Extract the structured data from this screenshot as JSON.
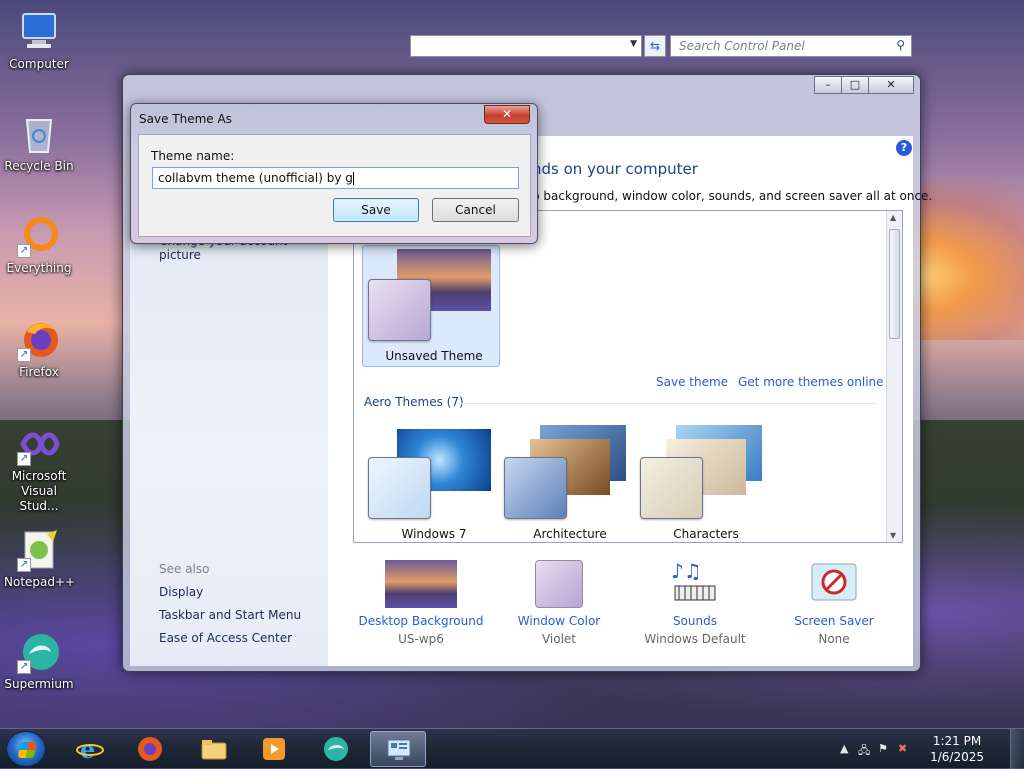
{
  "desktop": {
    "icons": [
      {
        "label": "Computer"
      },
      {
        "label": "Recycle Bin"
      },
      {
        "label": "Everything"
      },
      {
        "label": "Firefox"
      },
      {
        "label": "Microsoft Visual Stud..."
      },
      {
        "label": "Notepad++"
      },
      {
        "label": "Supermium"
      }
    ]
  },
  "control_panel": {
    "search_placeholder": "Search Control Panel",
    "heading_fragment": "nds on your computer",
    "subtitle_fragment": "p background, window color, sounds, and screen saver all at once.",
    "left_link_partial": "Change your account picture",
    "see_also_title": "See also",
    "see_also_links": [
      "Display",
      "Taskbar and Start Menu",
      "Ease of Access Center"
    ],
    "my_themes": {
      "name": "Unsaved Theme"
    },
    "save_theme_link": "Save theme",
    "get_more_link": "Get more themes online",
    "aero_title": "Aero Themes (7)",
    "aero_themes": [
      {
        "name": "Windows 7"
      },
      {
        "name": "Architecture"
      },
      {
        "name": "Characters"
      }
    ],
    "bottom": [
      {
        "title": "Desktop Background",
        "value": "US-wp6"
      },
      {
        "title": "Window Color",
        "value": "Violet"
      },
      {
        "title": "Sounds",
        "value": "Windows Default"
      },
      {
        "title": "Screen Saver",
        "value": "None"
      }
    ],
    "help_glyph": "?",
    "window_buttons": {
      "minimize": "–",
      "maximize": "□",
      "close": "✕"
    }
  },
  "dialog": {
    "title": "Save Theme As",
    "close_glyph": "✕",
    "label": "Theme name:",
    "input_value": "collabvm theme (unofficial) by g",
    "save": "Save",
    "cancel": "Cancel"
  },
  "taskbar": {
    "time": "1:21 PM",
    "date": "1/6/2025",
    "tray_arrow": "▲"
  }
}
